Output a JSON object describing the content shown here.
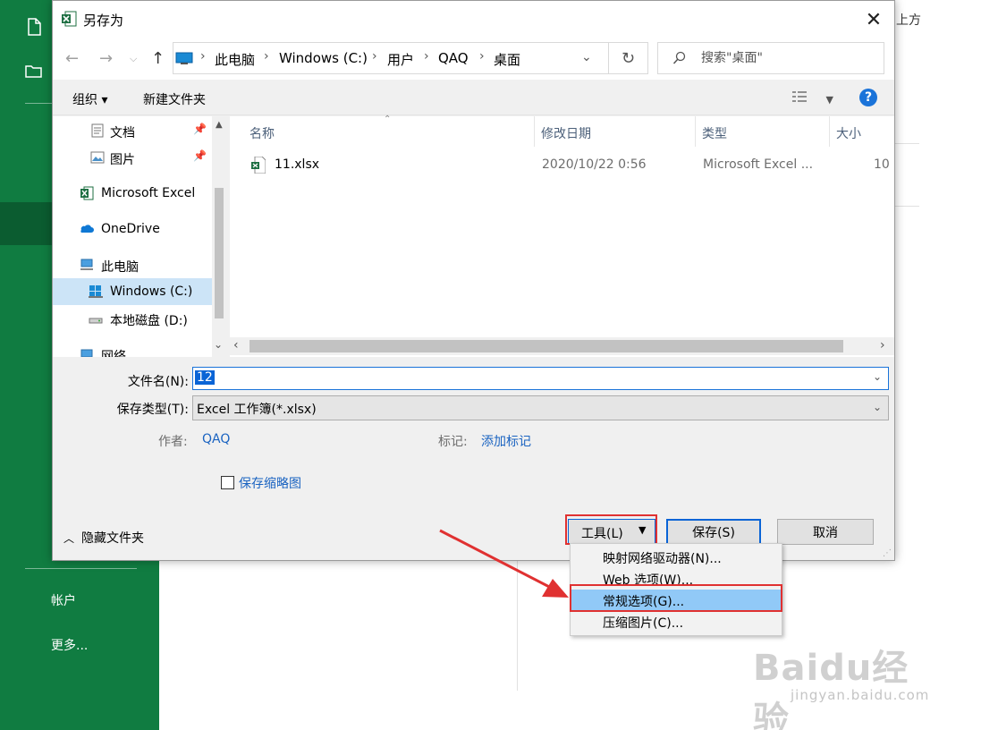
{
  "backstage": {
    "items": [
      "帐户",
      "更多..."
    ],
    "right_text": "上方"
  },
  "dialog": {
    "title": "另存为",
    "breadcrumbs": [
      "此电脑",
      "Windows (C:)",
      "用户",
      "QAQ",
      "桌面"
    ],
    "search_placeholder": "搜索\"桌面\"",
    "toolbar": {
      "organize": "组织 ▾",
      "new_folder": "新建文件夹"
    },
    "nav_items": [
      {
        "label": "文档",
        "pinned": true
      },
      {
        "label": "图片",
        "pinned": true
      },
      {
        "label": "Microsoft Excel",
        "pinned": false
      },
      {
        "label": "OneDrive",
        "pinned": false
      },
      {
        "label": "此电脑",
        "pinned": false
      },
      {
        "label": "Windows (C:)",
        "pinned": false,
        "selected": true
      },
      {
        "label": "本地磁盘 (D:)",
        "pinned": false
      },
      {
        "label": "网络",
        "pinned": false
      }
    ],
    "columns": [
      "名称",
      "修改日期",
      "类型",
      "大小"
    ],
    "files": [
      {
        "name": "11.xlsx",
        "modified": "2020/10/22 0:56",
        "type": "Microsoft Excel ...",
        "size": "10"
      }
    ],
    "form": {
      "filename_label": "文件名(N):",
      "filename_value": "12",
      "filetype_label": "保存类型(T):",
      "filetype_value": "Excel 工作簿(*.xlsx)",
      "author_label": "作者:",
      "author_value": "QAQ",
      "tags_label": "标记:",
      "tags_value": "添加标记",
      "thumbnail_label": "保存缩略图",
      "thumbnail_checked": false
    },
    "footer": {
      "hide_folders": "隐藏文件夹",
      "tools": "工具(L)",
      "save": "保存(S)",
      "cancel": "取消"
    },
    "tools_menu": [
      "映射网络驱动器(N)...",
      "Web 选项(W)...",
      "常规选项(G)...",
      "压缩图片(C)..."
    ],
    "highlighted_menu_item": "常规选项(G)..."
  },
  "watermark": {
    "brand": "Baidu经验",
    "url": "jingyan.baidu.com"
  },
  "colors": {
    "excel_green": "#107c41",
    "accent_blue": "#0a64d6",
    "annotation_red": "#e03131",
    "menu_highlight": "#91c9f7"
  }
}
